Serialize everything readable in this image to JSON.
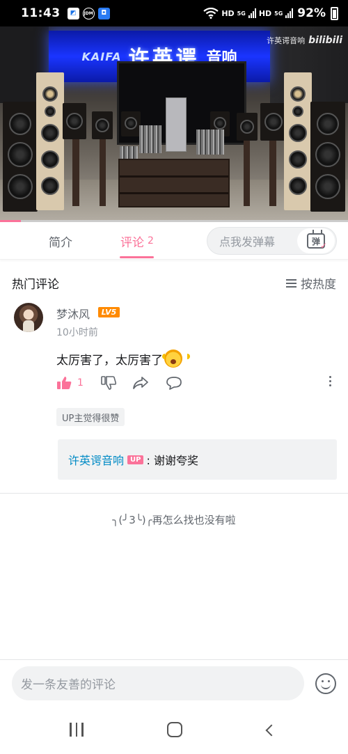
{
  "status_bar": {
    "time": "11:43",
    "app_icons": [
      "jd-app-icon",
      "jdm-app-icon",
      "shield-app-icon"
    ],
    "network_label_1": "HD",
    "network_label_2": "5G",
    "network_label_3": "HD",
    "network_label_4": "5G",
    "battery": "92%"
  },
  "video": {
    "banner_logo": "KAIFA",
    "banner_text": "许英谔",
    "banner_sub": "音响",
    "watermark_name": "许英谔音响",
    "watermark_logo": "bilibili",
    "progress_fraction": 0.06
  },
  "tabs": {
    "intro_label": "简介",
    "comments_label": "评论",
    "comments_count": "2",
    "danmaku_placeholder": "点我发弹幕",
    "danmaku_icon_char": "弹"
  },
  "comments": {
    "section_title": "热门评论",
    "sort_label": "按热度",
    "items": [
      {
        "username": "梦沐风",
        "level": "LV5",
        "time": "10小时前",
        "text": "太厉害了，太厉害了",
        "likes": "1",
        "up_tag": "UP主觉得很赞",
        "reply": {
          "user": "许英谔音响",
          "badge": "UP",
          "text": ": 谢谢夸奖"
        }
      }
    ],
    "end_note": "╮(╯3╰)╭再怎么找也没有啦"
  },
  "bottom": {
    "input_placeholder": "发一条友善的评论"
  },
  "colors": {
    "accent": "#fb7299",
    "link": "#008ac5",
    "level_badge": "#ff8a00"
  }
}
